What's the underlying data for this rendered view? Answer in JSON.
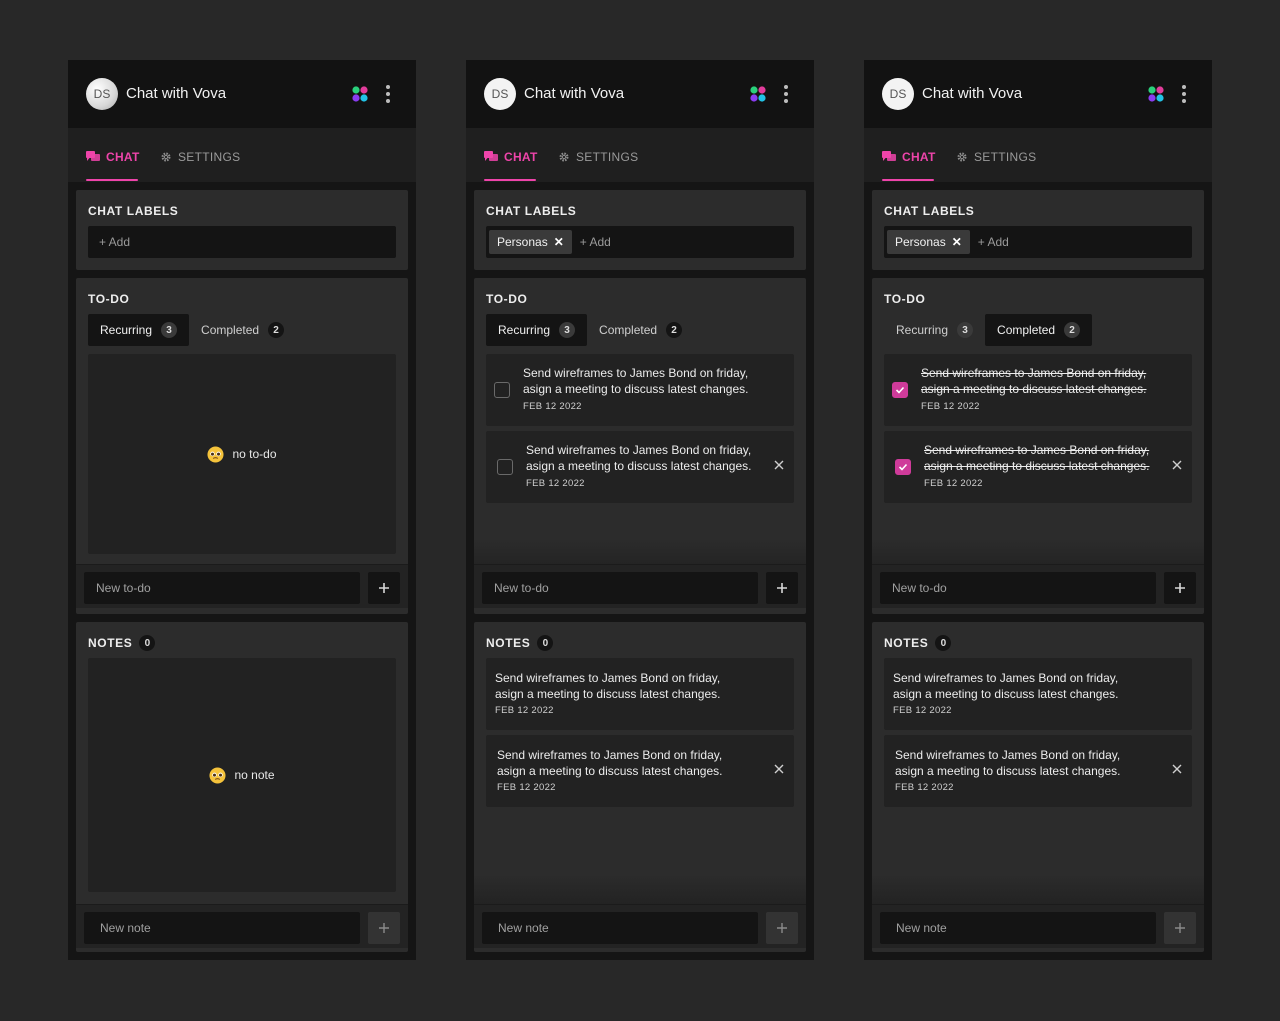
{
  "panels": [
    {
      "header": {
        "avatar_initials": "DS",
        "title": "Chat with Vova"
      },
      "tabs": {
        "chat": "CHAT",
        "settings": "SETTINGS"
      },
      "labels": {
        "title": "CHAT LABELS",
        "chips": [],
        "add": "+ Add"
      },
      "todo": {
        "title": "TO-DO",
        "segments": [
          {
            "label": "Recurring",
            "count": "3"
          },
          {
            "label": "Completed",
            "count": "2"
          }
        ],
        "empty_text": "no to-do",
        "input_placeholder": "New to-do"
      },
      "notes": {
        "title": "NOTES",
        "count": "0",
        "empty_text": "no note",
        "input_placeholder": "New note"
      }
    },
    {
      "header": {
        "avatar_initials": "DS",
        "title": "Chat with Vova"
      },
      "tabs": {
        "chat": "CHAT",
        "settings": "SETTINGS"
      },
      "labels": {
        "title": "CHAT LABELS",
        "chips": [
          "Personas"
        ],
        "add": "+ Add"
      },
      "todo": {
        "title": "TO-DO",
        "segments": [
          {
            "label": "Recurring",
            "count": "3"
          },
          {
            "label": "Completed",
            "count": "2"
          }
        ],
        "items": [
          {
            "text": "Send wireframes to James Bond on friday,\nasign a meeting to discuss latest changes.",
            "date": "FEB 12 2022"
          },
          {
            "text": "Send wireframes to James Bond on friday,\nasign a meeting to discuss latest changes.",
            "date": "FEB 12 2022"
          }
        ],
        "input_placeholder": "New to-do"
      },
      "notes": {
        "title": "NOTES",
        "count": "0",
        "items": [
          {
            "text": "Send wireframes to James Bond on friday,\nasign a meeting to discuss latest changes.",
            "date": "FEB 12 2022"
          },
          {
            "text": "Send wireframes to James Bond on friday,\nasign a meeting to discuss latest changes.",
            "date": "FEB 12 2022"
          }
        ],
        "input_placeholder": "New note"
      }
    },
    {
      "header": {
        "avatar_initials": "DS",
        "title": "Chat with Vova"
      },
      "tabs": {
        "chat": "CHAT",
        "settings": "SETTINGS"
      },
      "labels": {
        "title": "CHAT LABELS",
        "chips": [
          "Personas"
        ],
        "add": "+ Add"
      },
      "todo": {
        "title": "TO-DO",
        "segments": [
          {
            "label": "Recurring",
            "count": "3"
          },
          {
            "label": "Completed",
            "count": "2"
          }
        ],
        "items": [
          {
            "text": "Send wireframes to James Bond on friday,\nasign a meeting to discuss latest changes.",
            "date": "FEB 12 2022"
          },
          {
            "text": "Send wireframes to James Bond on friday,\nasign a meeting to discuss latest changes.",
            "date": "FEB 12 2022"
          }
        ],
        "input_placeholder": "New to-do"
      },
      "notes": {
        "title": "NOTES",
        "count": "0",
        "items": [
          {
            "text": "Send wireframes to James Bond on friday,\nasign a meeting to discuss latest changes.",
            "date": "FEB 12 2022"
          },
          {
            "text": "Send wireframes to James Bond on friday,\nasign a meeting to discuss latest changes.",
            "date": "FEB 12 2022"
          }
        ],
        "input_placeholder": "New note"
      }
    }
  ],
  "colors": {
    "background": "#282828",
    "panel": "#151515",
    "card": "#2c2c2c",
    "accent": "#ee44aa",
    "checkbox_checked": "#cf3b9a"
  },
  "icons": {
    "logo": "multicolor-petal-logo-icon",
    "menu": "kebab-menu-icon",
    "chat_tab": "chat-bubbles-icon",
    "settings_tab": "gear-icon",
    "empty_state": "pleading-face-emoji-icon"
  }
}
